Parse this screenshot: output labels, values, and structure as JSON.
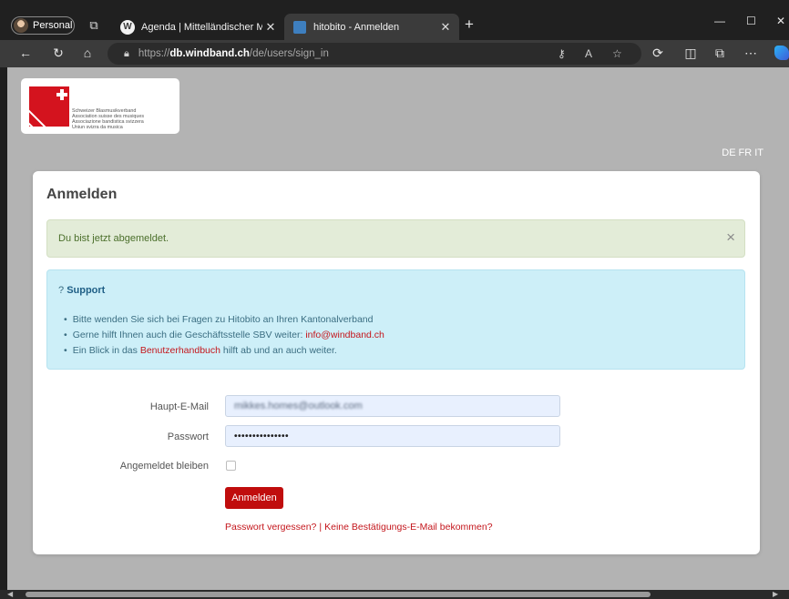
{
  "browser": {
    "profile_label": "Personal",
    "tabs": [
      {
        "title": "Agenda | Mittelländischer Musikv",
        "icon": "wordpress-icon",
        "active": false
      },
      {
        "title": "hitobito - Anmelden",
        "icon": "hitobito-favicon",
        "active": true
      }
    ],
    "address": {
      "prefix": "https://",
      "domain": "db.windband.ch",
      "path": "/de/users/sign_in"
    }
  },
  "page": {
    "logo": {
      "lines": [
        "Schweizer Blasmusikverband",
        "Association suisse des musiques",
        "Associazione bandistica svizzera",
        "Uniun svizra da musica"
      ]
    },
    "languages": [
      "DE",
      "FR",
      "IT"
    ],
    "title": "Anmelden",
    "flash": {
      "message": "Du bist jetzt abgemeldet.",
      "close": "×"
    },
    "support": {
      "prefix": "?",
      "heading": "Support",
      "item1": "Bitte wenden Sie sich bei Fragen zu Hitobito an Ihren Kantonalverband",
      "item2_text": "Gerne hilft Ihnen auch die Geschäftsstelle SBV weiter: ",
      "item2_link": "info@windband.ch",
      "item3_text_pre": "Ein Blick in das ",
      "item3_link": "Benutzerhandbuch",
      "item3_text_post": " hilft ab und an auch weiter."
    },
    "form": {
      "email_label": "Haupt-E-Mail",
      "email_value": "mikkes.homes@outlook.com",
      "password_label": "Passwort",
      "password_value": "•••••••••••••••",
      "remember_label": "Angemeldet bleiben",
      "remember_checked": false,
      "submit_label": "Anmelden",
      "forgot_link": "Passwort vergessen?",
      "separator": "|",
      "no_confirmation_link": "Keine Bestätigungs-E-Mail bekommen?"
    }
  },
  "colors": {
    "accent_red": "#c00d0d",
    "info_bg": "#cdeff8",
    "success_bg": "#e3ecd8"
  }
}
